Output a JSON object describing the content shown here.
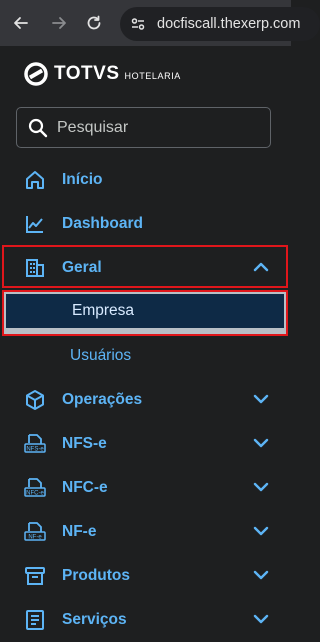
{
  "browser": {
    "url": "docfiscall.thexerp.com"
  },
  "logo": {
    "brand": "TOTVS",
    "product": "HOTELARIA"
  },
  "search": {
    "placeholder": "Pesquisar"
  },
  "menu": {
    "inicio": "Início",
    "dashboard": "Dashboard",
    "geral": "Geral",
    "empresa": "Empresa",
    "usuarios": "Usuários",
    "operacoes": "Operações",
    "nfse": "NFS-e",
    "nfce": "NFC-e",
    "nfe": "NF-e",
    "produtos": "Produtos",
    "servicos": "Serviços"
  },
  "icons": {
    "nfse_tag": "NFS-e",
    "nfce_tag": "NFC-e",
    "nfe_tag": "NF-e"
  },
  "colors": {
    "accent": "#5db4f5",
    "highlight_border": "#e0161b",
    "selected_bg": "#0e2a46"
  }
}
